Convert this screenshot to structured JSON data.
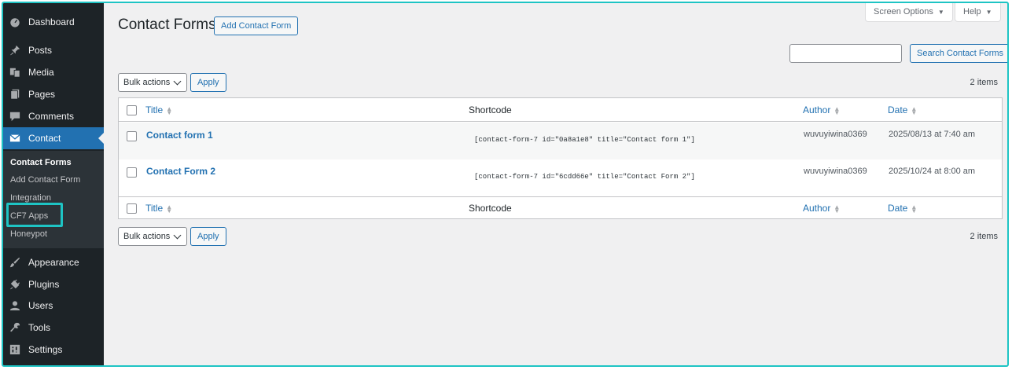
{
  "sidebar": {
    "items": [
      {
        "label": "Dashboard",
        "icon": "dashboard-icon"
      },
      {
        "label": "Posts",
        "icon": "pin-icon"
      },
      {
        "label": "Media",
        "icon": "media-icon"
      },
      {
        "label": "Pages",
        "icon": "pages-icon"
      },
      {
        "label": "Comments",
        "icon": "comment-icon"
      },
      {
        "label": "Contact",
        "icon": "mail-icon"
      },
      {
        "label": "Appearance",
        "icon": "brush-icon"
      },
      {
        "label": "Plugins",
        "icon": "plug-icon"
      },
      {
        "label": "Users",
        "icon": "users-icon"
      },
      {
        "label": "Tools",
        "icon": "wrench-icon"
      },
      {
        "label": "Settings",
        "icon": "settings-icon"
      }
    ],
    "submenu": [
      "Contact Forms",
      "Add Contact Form",
      "Integration",
      "CF7 Apps",
      "Honeypot"
    ]
  },
  "header": {
    "title": "Contact Forms",
    "add_button": "Add Contact Form",
    "screen_options": "Screen Options",
    "help": "Help"
  },
  "search": {
    "value": "",
    "button": "Search Contact Forms"
  },
  "bulk": {
    "select_label": "Bulk actions",
    "apply": "Apply"
  },
  "items_count": "2 items",
  "table": {
    "columns": [
      "Title",
      "Shortcode",
      "Author",
      "Date"
    ],
    "rows": [
      {
        "title": "Contact form 1",
        "shortcode": "[contact-form-7 id=\"0a8a1e8\" title=\"Contact form 1\"]",
        "author": "wuvuyiwina0369",
        "date": "2025/08/13 at 7:40 am"
      },
      {
        "title": "Contact Form 2",
        "shortcode": "[contact-form-7 id=\"6cdd66e\" title=\"Contact Form 2\"]",
        "author": "wuvuyiwina0369",
        "date": "2025/10/24 at 8:00 am"
      }
    ]
  },
  "colors": {
    "sidebar_bg": "#1d2327",
    "accent": "#2271b1",
    "highlight": "#1ec4c4"
  }
}
